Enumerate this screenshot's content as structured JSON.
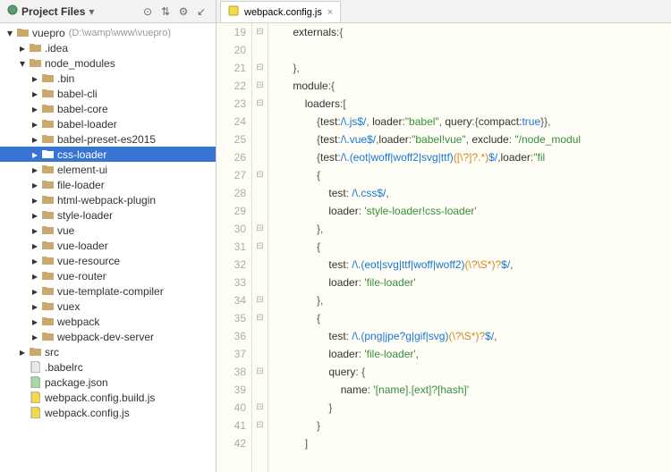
{
  "sidebar": {
    "title": "Project Files",
    "root": {
      "label": "vuepro",
      "hint": "(D:\\wamp\\www\\vuepro)"
    },
    "idea": ".idea",
    "node_modules": "node_modules",
    "nm_children": [
      ".bin",
      "babel-cli",
      "babel-core",
      "babel-loader",
      "babel-preset-es2015",
      "css-loader",
      "element-ui",
      "file-loader",
      "html-webpack-plugin",
      "style-loader",
      "vue",
      "vue-loader",
      "vue-resource",
      "vue-router",
      "vue-template-compiler",
      "vuex",
      "webpack",
      "webpack-dev-server"
    ],
    "src": "src",
    "files": [
      ".babelrc",
      "package.json",
      "webpack.config.build.js",
      "webpack.config.js"
    ]
  },
  "editor": {
    "tab": "webpack.config.js",
    "line_start": 19,
    "line_end": 42,
    "fold_markers": {
      "19": "⊟",
      "20": "",
      "21": "⊟",
      "22": "⊟",
      "23": "⊟",
      "24": "",
      "25": "",
      "26": "",
      "27": "⊟",
      "28": "",
      "29": "",
      "30": "⊟",
      "31": "⊟",
      "32": "",
      "33": "",
      "34": "⊟",
      "35": "⊟",
      "36": "",
      "37": "",
      "38": "⊟",
      "39": "",
      "40": "⊟",
      "41": "⊟",
      "42": ""
    },
    "lines": {
      "l19": {
        "indent": "       ",
        "parts": [
          {
            "t": "externals",
            "c": "prop"
          },
          {
            "t": ":",
            "c": "punc"
          },
          {
            "t": "{",
            "c": "punc"
          }
        ]
      },
      "l20": {
        "indent": "",
        "parts": []
      },
      "l21": {
        "indent": "       ",
        "parts": [
          {
            "t": "},",
            "c": "punc"
          }
        ]
      },
      "l22": {
        "indent": "       ",
        "parts": [
          {
            "t": "module",
            "c": "prop"
          },
          {
            "t": ":",
            "c": "punc"
          },
          {
            "t": "{",
            "c": "punc"
          }
        ]
      },
      "l23": {
        "indent": "           ",
        "parts": [
          {
            "t": "loaders",
            "c": "prop"
          },
          {
            "t": ":[",
            "c": "punc"
          }
        ]
      },
      "l24": {
        "indent": "               ",
        "parts": [
          {
            "t": "{",
            "c": "punc"
          },
          {
            "t": "test",
            "c": "prop"
          },
          {
            "t": ":",
            "c": "punc"
          },
          {
            "t": "/\\.js$/",
            "c": "re"
          },
          {
            "t": ", ",
            "c": "punc"
          },
          {
            "t": "loader",
            "c": "prop"
          },
          {
            "t": ":",
            "c": "punc"
          },
          {
            "t": "\"babel\"",
            "c": "str"
          },
          {
            "t": ", ",
            "c": "punc"
          },
          {
            "t": "query",
            "c": "prop"
          },
          {
            "t": ":",
            "c": "punc"
          },
          {
            "t": "{",
            "c": "punc"
          },
          {
            "t": "compact",
            "c": "prop"
          },
          {
            "t": ":",
            "c": "punc"
          },
          {
            "t": "true",
            "c": "kw"
          },
          {
            "t": "}}",
            "c": "punc"
          },
          {
            "t": ",",
            "c": "punc"
          }
        ]
      },
      "l25": {
        "indent": "               ",
        "parts": [
          {
            "t": "{",
            "c": "punc"
          },
          {
            "t": "test",
            "c": "prop"
          },
          {
            "t": ":",
            "c": "punc"
          },
          {
            "t": "/\\.vue$/",
            "c": "re"
          },
          {
            "t": ",",
            "c": "punc"
          },
          {
            "t": "loader",
            "c": "prop"
          },
          {
            "t": ":",
            "c": "punc"
          },
          {
            "t": "\"babel!vue\"",
            "c": "str"
          },
          {
            "t": ", ",
            "c": "punc"
          },
          {
            "t": "exclude",
            "c": "prop"
          },
          {
            "t": ": ",
            "c": "punc"
          },
          {
            "t": "\"/node_modul",
            "c": "str"
          }
        ]
      },
      "l26": {
        "indent": "               ",
        "parts": [
          {
            "t": "{",
            "c": "punc"
          },
          {
            "t": "test",
            "c": "prop"
          },
          {
            "t": ":",
            "c": "punc"
          },
          {
            "t": "/\\.(eot|woff|woff2|svg|ttf)",
            "c": "re"
          },
          {
            "t": "([\\?]?.*)",
            "c": "rep"
          },
          {
            "t": "$/",
            "c": "re"
          },
          {
            "t": ",",
            "c": "punc"
          },
          {
            "t": "loader",
            "c": "prop"
          },
          {
            "t": ":",
            "c": "punc"
          },
          {
            "t": "\"fil",
            "c": "str"
          }
        ]
      },
      "l27": {
        "indent": "               ",
        "parts": [
          {
            "t": "{",
            "c": "punc"
          }
        ]
      },
      "l28": {
        "indent": "                   ",
        "parts": [
          {
            "t": "test",
            "c": "prop"
          },
          {
            "t": ": ",
            "c": "punc"
          },
          {
            "t": "/\\.css$/",
            "c": "re"
          },
          {
            "t": ",",
            "c": "punc"
          }
        ]
      },
      "l29": {
        "indent": "                   ",
        "parts": [
          {
            "t": "loader",
            "c": "prop"
          },
          {
            "t": ": ",
            "c": "punc"
          },
          {
            "t": "'style-loader!css-loader'",
            "c": "str"
          }
        ]
      },
      "l30": {
        "indent": "               ",
        "parts": [
          {
            "t": "},",
            "c": "punc"
          }
        ]
      },
      "l31": {
        "indent": "               ",
        "parts": [
          {
            "t": "{",
            "c": "punc"
          }
        ]
      },
      "l32": {
        "indent": "                   ",
        "parts": [
          {
            "t": "test",
            "c": "prop"
          },
          {
            "t": ": ",
            "c": "punc"
          },
          {
            "t": "/\\.(eot|svg|ttf|woff|woff2)",
            "c": "re"
          },
          {
            "t": "(\\?\\S*)?",
            "c": "rep"
          },
          {
            "t": "$/",
            "c": "re"
          },
          {
            "t": ",",
            "c": "punc"
          }
        ]
      },
      "l33": {
        "indent": "                   ",
        "parts": [
          {
            "t": "loader",
            "c": "prop"
          },
          {
            "t": ": ",
            "c": "punc"
          },
          {
            "t": "'file-loader'",
            "c": "str"
          }
        ]
      },
      "l34": {
        "indent": "               ",
        "parts": [
          {
            "t": "},",
            "c": "punc"
          }
        ]
      },
      "l35": {
        "indent": "               ",
        "parts": [
          {
            "t": "{",
            "c": "punc"
          }
        ]
      },
      "l36": {
        "indent": "                   ",
        "parts": [
          {
            "t": "test",
            "c": "prop"
          },
          {
            "t": ": ",
            "c": "punc"
          },
          {
            "t": "/\\.(png|jpe?g|gif|svg)",
            "c": "re"
          },
          {
            "t": "(\\?\\S*)?",
            "c": "rep"
          },
          {
            "t": "$/",
            "c": "re"
          },
          {
            "t": ",",
            "c": "punc"
          }
        ]
      },
      "l37": {
        "indent": "                   ",
        "parts": [
          {
            "t": "loader",
            "c": "prop"
          },
          {
            "t": ": ",
            "c": "punc"
          },
          {
            "t": "'file-loader'",
            "c": "str"
          },
          {
            "t": ",",
            "c": "punc"
          }
        ]
      },
      "l38": {
        "indent": "                   ",
        "parts": [
          {
            "t": "query",
            "c": "prop"
          },
          {
            "t": ": ",
            "c": "punc"
          },
          {
            "t": "{",
            "c": "punc"
          }
        ]
      },
      "l39": {
        "indent": "                       ",
        "parts": [
          {
            "t": "name",
            "c": "prop"
          },
          {
            "t": ": ",
            "c": "punc"
          },
          {
            "t": "'[name].[ext]?[hash]'",
            "c": "str"
          }
        ]
      },
      "l40": {
        "indent": "                   ",
        "parts": [
          {
            "t": "}",
            "c": "punc"
          }
        ]
      },
      "l41": {
        "indent": "               ",
        "parts": [
          {
            "t": "}",
            "c": "punc"
          }
        ]
      },
      "l42": {
        "indent": "           ",
        "parts": [
          {
            "t": "]",
            "c": "punc"
          }
        ]
      }
    }
  }
}
